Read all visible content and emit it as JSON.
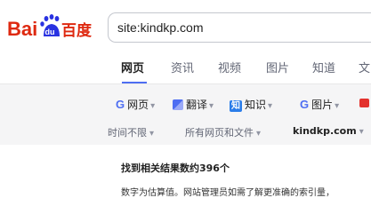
{
  "logo": {
    "text_left": "Bai",
    "text_right": "百度",
    "paw_text": "du",
    "brand_red": "#de2910",
    "brand_blue": "#2932e1"
  },
  "search": {
    "value": "site:kindkp.com"
  },
  "tabs": [
    {
      "label": "网页",
      "active": true
    },
    {
      "label": "资讯",
      "active": false
    },
    {
      "label": "视频",
      "active": false
    },
    {
      "label": "图片",
      "active": false
    },
    {
      "label": "知道",
      "active": false
    },
    {
      "label": "文",
      "active": false
    }
  ],
  "tools": {
    "web": {
      "icon": "G",
      "label": "网页"
    },
    "translate": {
      "icon": "translate-icon",
      "label": "翻译"
    },
    "zhidao": {
      "icon": "知",
      "label": "知识"
    },
    "image": {
      "icon": "G",
      "label": "图片"
    },
    "video": {
      "icon": "video-icon"
    }
  },
  "filters": {
    "time": "时间不限",
    "doc": "所有网页和文件",
    "site": "kindkp.com"
  },
  "results": {
    "count_text": "找到相关结果数约396个",
    "note": "数字为估算值。网站管理员如需了解更准确的索引量，"
  },
  "colors": {
    "accent": "#4e6ef2",
    "toolbar_bg": "#f5f5f6"
  }
}
